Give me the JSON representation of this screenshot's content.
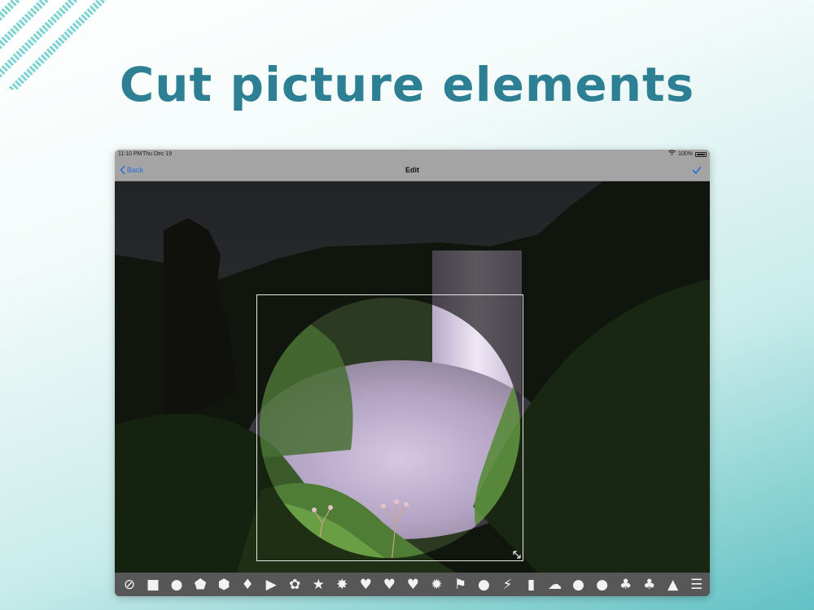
{
  "headline": "Cut picture elements",
  "status_bar": {
    "time": "11:10 PM",
    "date": "Thu Dec 19",
    "battery": "100%"
  },
  "nav": {
    "back_label": "Back",
    "title": "Edit",
    "done_icon": "checkmark-icon"
  },
  "canvas": {
    "crop_shape": "circle",
    "resize_handle_icon": "resize-arrows-icon"
  },
  "toolbar": {
    "shapes": [
      {
        "name": "none-icon",
        "glyph": "⊘"
      },
      {
        "name": "square-icon",
        "glyph": "■"
      },
      {
        "name": "circle-icon",
        "glyph": "●"
      },
      {
        "name": "pentagon-icon",
        "glyph": "⬟"
      },
      {
        "name": "hexagon-icon",
        "glyph": "⬢"
      },
      {
        "name": "diamond-icon",
        "glyph": "♦"
      },
      {
        "name": "triangle-icon",
        "glyph": "▶"
      },
      {
        "name": "flower-icon",
        "glyph": "✿"
      },
      {
        "name": "star-icon",
        "glyph": "★"
      },
      {
        "name": "burst-icon",
        "glyph": "✸"
      },
      {
        "name": "heart-icon",
        "glyph": "♥"
      },
      {
        "name": "heartbeat-icon",
        "glyph": "♥"
      },
      {
        "name": "broken-heart-icon",
        "glyph": "♥"
      },
      {
        "name": "spark-icon",
        "glyph": "✹"
      },
      {
        "name": "flag-icon",
        "glyph": "⚑"
      },
      {
        "name": "speech-bubble-icon",
        "glyph": "●"
      },
      {
        "name": "lightning-icon",
        "glyph": "⚡"
      },
      {
        "name": "bookmark-icon",
        "glyph": "▮"
      },
      {
        "name": "cloud-icon",
        "glyph": "☁"
      },
      {
        "name": "apple-icon",
        "glyph": "●"
      },
      {
        "name": "pear-icon",
        "glyph": "●"
      },
      {
        "name": "clover-icon",
        "glyph": "♣"
      },
      {
        "name": "tree-icon",
        "glyph": "♣"
      },
      {
        "name": "pine-tree-icon",
        "glyph": "▲"
      },
      {
        "name": "menu-icon",
        "glyph": "☰"
      }
    ]
  },
  "colors": {
    "accent": "#2b6fd6",
    "headline": "#2d7f93",
    "toolbar_bg": "#575757",
    "nav_bg": "#a4a4a4"
  }
}
